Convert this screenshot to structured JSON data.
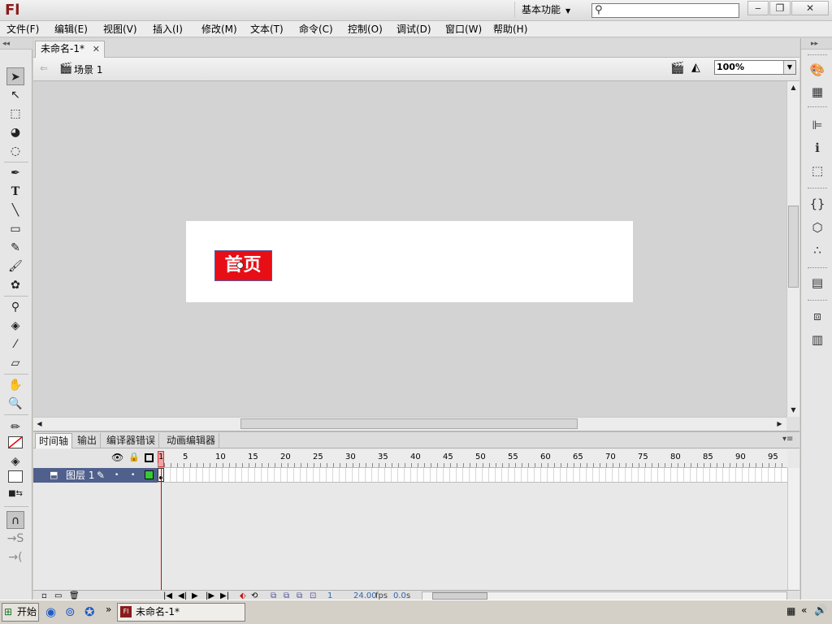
{
  "app": {
    "logo": "Fl",
    "workspace": "基本功能",
    "search_placeholder": ""
  },
  "menu": [
    {
      "label": "文件(F)"
    },
    {
      "label": "编辑(E)"
    },
    {
      "label": "视图(V)"
    },
    {
      "label": "插入(I)"
    },
    {
      "label": "修改(M)"
    },
    {
      "label": "文本(T)"
    },
    {
      "label": "命令(C)"
    },
    {
      "label": "控制(O)"
    },
    {
      "label": "调试(D)"
    },
    {
      "label": "窗口(W)"
    },
    {
      "label": "帮助(H)"
    }
  ],
  "document": {
    "tab_title": "未命名-1*",
    "scene": "场景 1",
    "zoom": "100%"
  },
  "stage": {
    "button_text": "首页",
    "button_color": "#e80e16"
  },
  "timeline": {
    "tabs": [
      "时间轴",
      "输出",
      "编译器错误",
      "动画编辑器"
    ],
    "layer_name": "图层 1",
    "current_frame": "1",
    "frame_numbers": [
      "1",
      "5",
      "10",
      "15",
      "20",
      "25",
      "30",
      "35",
      "40",
      "45",
      "50",
      "55",
      "60",
      "65",
      "70",
      "75",
      "80",
      "85",
      "90",
      "95"
    ],
    "status_frame": "1",
    "fps": "24.00",
    "fps_unit": "fps",
    "time": "0.0",
    "time_unit": "s"
  },
  "taskbar": {
    "start_label": "开始",
    "task_title": "未命名-1*"
  }
}
